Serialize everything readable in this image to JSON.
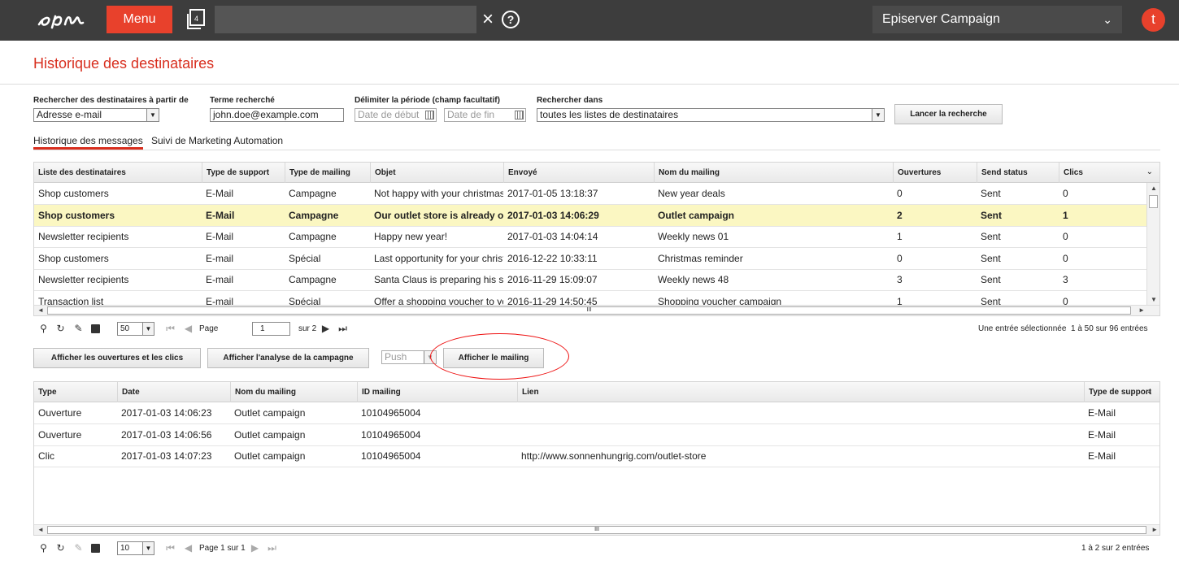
{
  "topbar": {
    "menu_label": "Menu",
    "tabs_count": "4",
    "search_value": "",
    "client_name": "Episerver Campaign",
    "avatar_letter": "t"
  },
  "page_title": "Historique des destinataires",
  "search_form": {
    "search_by_label": "Rechercher des destinataires à partir de",
    "search_by_value": "Adresse e-mail",
    "term_label": "Terme recherché",
    "term_value": "john.doe@example.com",
    "period_label": "Délimiter la période (champ facultatif)",
    "start_placeholder": "Date de début",
    "end_placeholder": "Date de fin",
    "search_in_label": "Rechercher dans",
    "search_in_value": "toutes les listes de destinataires",
    "submit_label": "Lancer la recherche"
  },
  "subtabs": [
    "Historique des messages",
    "Suivi de Marketing Automation"
  ],
  "messages_grid": {
    "columns": [
      "Liste des destinataires",
      "Type de support",
      "Type de mailing",
      "Objet",
      "Envoyé",
      "Nom du mailing",
      "Ouvertures",
      "Send status",
      "Clics"
    ],
    "rows": [
      [
        "Shop customers",
        "E-Mail",
        "Campagne",
        "Not happy with your christmas gifts?",
        "2017-01-05 13:18:37",
        "New year deals",
        "0",
        "Sent",
        "0"
      ],
      [
        "Shop customers",
        "E-Mail",
        "Campagne",
        "Our outlet store is already open",
        "2017-01-03 14:06:29",
        "Outlet campaign",
        "2",
        "Sent",
        "1"
      ],
      [
        "Newsletter recipients",
        "E-Mail",
        "Campagne",
        "Happy new year!",
        "2017-01-03 14:04:14",
        "Weekly news 01",
        "1",
        "Sent",
        "0"
      ],
      [
        "Shop customers",
        "E-mail",
        "Spécial",
        "Last opportunity for your christmas gifts",
        "2016-12-22 10:33:11",
        "Christmas reminder",
        "0",
        "Sent",
        "0"
      ],
      [
        "Newsletter recipients",
        "E-mail",
        "Campagne",
        "Santa Claus is preparing his sleigh",
        "2016-11-29 15:09:07",
        "Weekly news 48",
        "3",
        "Sent",
        "3"
      ],
      [
        "Transaction list",
        "E-mail",
        "Spécial",
        "Offer a shopping voucher to your friends",
        "2016-11-29 14:50:45",
        "Shopping voucher campaign",
        "1",
        "Sent",
        "0"
      ]
    ],
    "selected_row": 1,
    "scroll_glyph": "III"
  },
  "messages_pager": {
    "page_size": "50",
    "page_label": "Page",
    "page_value": "1",
    "of_label": "sur 2",
    "selection_info": "Une entrée sélectionnée",
    "range_info": "1 à 50 sur 96 entrées"
  },
  "actions": {
    "show_opens_clicks": "Afficher les ouvertures et les clics",
    "show_campaign_analysis": "Afficher l'analyse de la campagne",
    "channel_value": "Push",
    "show_mailing": "Afficher le mailing"
  },
  "events_grid": {
    "columns": [
      "Type",
      "Date",
      "Nom du mailing",
      "ID mailing",
      "Lien",
      "Type de support"
    ],
    "rows": [
      [
        "Ouverture",
        "2017-01-03 14:06:23",
        "Outlet campaign",
        "10104965004",
        "",
        "E-Mail"
      ],
      [
        "Ouverture",
        "2017-01-03 14:06:56",
        "Outlet campaign",
        "10104965004",
        "",
        "E-Mail"
      ],
      [
        "Clic",
        "2017-01-03 14:07:23",
        "Outlet campaign",
        "10104965004",
        "http://www.sonnenhungrig.com/outlet-store",
        "E-Mail"
      ]
    ],
    "scroll_glyph": "III"
  },
  "events_pager": {
    "page_size": "10",
    "page_info": "Page 1 sur 1",
    "range_info": "1 à 2 sur 2 entrées"
  },
  "colors": {
    "accent": "#e8412c",
    "topbar": "#3d3d3d",
    "title": "#d82e1e",
    "selected_row": "#fbf7c2",
    "highlight_ellipse": "#ee1111"
  },
  "icons": [
    "logo",
    "menu",
    "tabs-icon",
    "clear-icon",
    "help-icon",
    "chevron-down-icon",
    "calendar-icon",
    "search-icon",
    "refresh-icon",
    "eraser-icon",
    "save-icon",
    "first-page-icon",
    "prev-page-icon",
    "next-page-icon",
    "last-page-icon"
  ]
}
